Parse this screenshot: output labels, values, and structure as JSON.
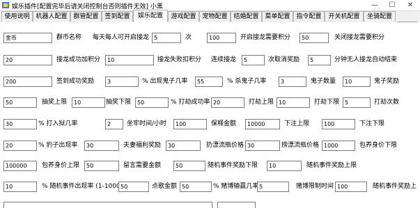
{
  "window": {
    "title": "娱乐插件[配置完毕后请关闭控制台否则插件无效] 小黑",
    "controls": {
      "minimize": "—",
      "maximize": "☐",
      "close": "✕"
    }
  },
  "tabs": [
    "使用说明",
    "机器人配置",
    "群管配置",
    "签到配置",
    "娱乐配置",
    "游戏配置",
    "宠物配置",
    "结婚配置",
    "菜单配置",
    "指令配置",
    "开关机配置",
    "坐骑配置"
  ],
  "active_tab": "娱乐配置",
  "form": {
    "r1": {
      "currency": "金币",
      "currency_label": "群币名称",
      "daily_label": "每天每人可开启接龙",
      "daily_value": "5",
      "daily_unit": "次",
      "open_cost": "100",
      "open_cost_label": "开启接龙需要积分",
      "close_cost": "50",
      "close_cost_label": "关闭接龙需要积分"
    },
    "r2": {
      "success_points": "20",
      "success_label": "接龙成功加积分",
      "fail_points": "10",
      "fail_label": "接龙失败扣积分",
      "streak_label": "连续接龙",
      "streak_value": "5",
      "streak_unit": "次取消奖励",
      "idle_value": "5",
      "idle_label": "分钟无人接龙自动结束"
    },
    "r3": {
      "sign_reward": "200",
      "sign_label": "签到成功奖励",
      "ghost_rate": "3",
      "ghost_rate_label": "% 出现鬼子几率",
      "kill_rate": "55",
      "kill_rate_label": "% 杀鬼子几率",
      "ghost_count": "3",
      "ghost_count_label": "鬼子数量",
      "ghost_reward": "10",
      "ghost_reward_label": "鬼子奖励"
    },
    "r4": {
      "rob_upper": "50",
      "rob_upper_label": "抽奖上限",
      "rob_lower": "10",
      "rob_lower_label": "抽奖下限",
      "rob_success": "50",
      "rob_success_label": "% 打劫成功率",
      "hit_upper": "20",
      "hit_upper_label": "打劫上限",
      "hit_lower": "10",
      "hit_lower_label": "打劫下限",
      "hit_times": "5",
      "hit_times_label": "打劫次数"
    },
    "r5": {
      "jail_rate": "30",
      "jail_rate_label": "% 打入狱几率",
      "jail_time": "2",
      "jail_time_label": "坐牢时间/小时",
      "bail": "100",
      "bail_label": "保释金额",
      "bet_upper": "10000",
      "bet_upper_label": "下注上限",
      "bet_lower": "100",
      "bet_lower_label": "下注下限"
    },
    "r6": {
      "child_rate": "20",
      "child_rate_label": "% 豹子出现率",
      "spouse_bonus": "30",
      "spouse_bonus_label": "夫妻福利奖励",
      "bottle_throw": "30",
      "bottle_throw_label": "扔漂流瓶价格",
      "bottle_pick": "30",
      "bottle_pick_label": "捞漂流瓶价格",
      "buy_lower": "1000",
      "buy_lower_label": "包养身价下限"
    },
    "r7": {
      "buy_upper": "100000",
      "buy_upper_label": "包养身价上限",
      "msg_cost": "50",
      "msg_cost_label": "留言需要金额",
      "event_lower": "50",
      "event_lower_label": "随机事件奖励下限",
      "event_upper": "10",
      "event_upper_label": "随机事件奖励上限"
    },
    "r8": {
      "event_rate": "10",
      "event_rate_label": "% 随机事件出现率 (1-1000)",
      "tip_amount": "50",
      "tip_label": "点歌金额",
      "gamble_rate": "50",
      "gamble_rate_label": "% 赌博输赢几率",
      "gamble_limit": "5",
      "gamble_limit_label": "赌博限制时间",
      "event_upper2": "100",
      "event_upper2_label": "随机事件奖励上"
    }
  }
}
